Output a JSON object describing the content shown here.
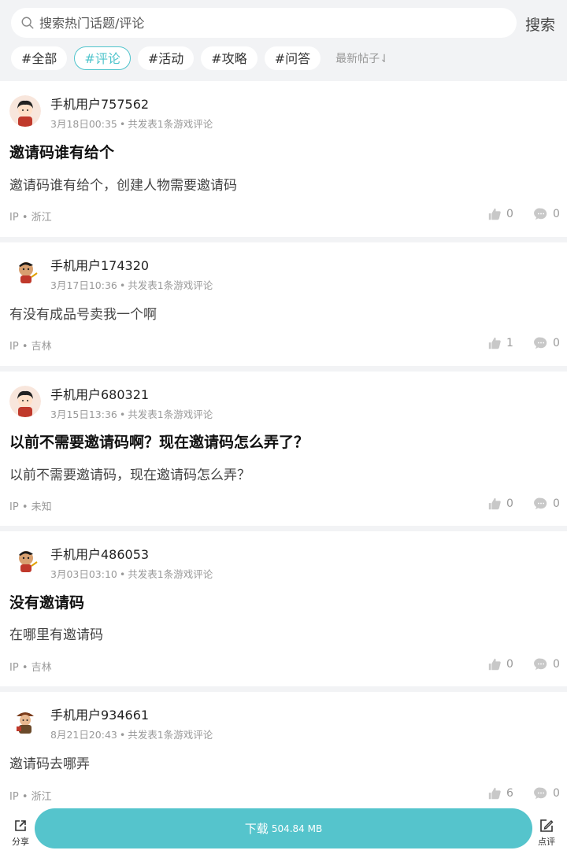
{
  "search": {
    "placeholder": "搜索热门话题/评论",
    "button": "搜索"
  },
  "tags": [
    "#全部",
    "#评论",
    "#活动",
    "#攻略",
    "#问答"
  ],
  "active_tag_index": 1,
  "sort_label": "最新帖子⇃",
  "posts_meta_sep": "•",
  "posts": [
    {
      "user": "手机用户757562",
      "time": "3月18日00:35",
      "count": "共发表1条游戏评论",
      "title": "邀请码谁有给个",
      "body": "邀请码谁有给个，创建人物需要邀请码",
      "ip_label": "IP",
      "location": "浙江",
      "likes": "0",
      "comments": "0",
      "avatar": "boy-avatar"
    },
    {
      "user": "手机用户174320",
      "time": "3月17日10:36",
      "count": "共发表1条游戏评论",
      "title": "",
      "body": "有没有成品号卖我一个啊",
      "ip_label": "IP",
      "location": "吉林",
      "likes": "1",
      "comments": "0",
      "avatar": "monkey-avatar"
    },
    {
      "user": "手机用户680321",
      "time": "3月15日13:36",
      "count": "共发表1条游戏评论",
      "title": "以前不需要邀请码啊？现在邀请码怎么弄了？",
      "body": "以前不需要邀请码，现在邀请码怎么弄？",
      "ip_label": "IP",
      "location": "未知",
      "likes": "0",
      "comments": "0",
      "avatar": "boy-avatar"
    },
    {
      "user": "手机用户486053",
      "time": "3月03日03:10",
      "count": "共发表1条游戏评论",
      "title": "没有邀请码",
      "body": "在哪里有邀请码",
      "ip_label": "IP",
      "location": "吉林",
      "likes": "0",
      "comments": "0",
      "avatar": "monkey-avatar"
    },
    {
      "user": "手机用户934661",
      "time": "8月21日20:43",
      "count": "共发表1条游戏评论",
      "title": "",
      "body": "邀请码去哪弄",
      "ip_label": "IP",
      "location": "浙江",
      "likes": "6",
      "comments": "0",
      "avatar": "warrior-avatar"
    }
  ],
  "bottom": {
    "share": "分享",
    "download": "下载",
    "size": "504.84 MB",
    "review": "点评"
  },
  "colors": {
    "accent": "#55c4cc",
    "background": "#f2f3f5"
  }
}
